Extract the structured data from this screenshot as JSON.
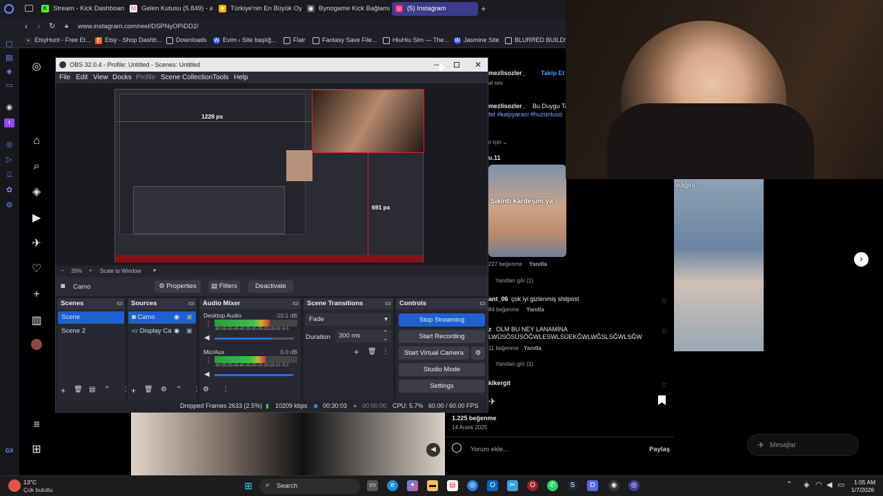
{
  "browser": {
    "tabs": [
      {
        "label": "Stream - Kick Dashboard",
        "icon": "kick-icon",
        "color": "#53fc18"
      },
      {
        "label": "Gelen Kutusu (5.849) - a...",
        "icon": "gmail-icon",
        "color": "#ea4335"
      },
      {
        "label": "Türkiye'nin En Büyük Oyu...",
        "icon": "site-icon",
        "color": "#f5b400"
      },
      {
        "label": "Bynogame Kick Bağlama",
        "icon": "globe-icon",
        "color": "#888888"
      },
      {
        "label": "(5) Instagram",
        "icon": "instagram-icon",
        "color": "#e1306c"
      }
    ],
    "url": "www.instagram.com/reel/DSPNyOPiDD2/",
    "bookmarks": [
      "EtsyHunt - Free Et...",
      "Etsy - Shop Dashb...",
      "Downloads",
      "Evim ‹ Site başlığ...",
      "Flair",
      "Fantasy Save File...",
      "HiuHiu Sim — The...",
      "Jasmine Site",
      "BLURRED BUILDS..."
    ]
  },
  "instagram": {
    "username": "mezlisozler_",
    "follow": "Takip Et",
    "audio": "al ses",
    "caption_user": "mezlisozler_",
    "caption": "Bu Duygu Tan",
    "hashtags": "fet #kalpyarası #huzunlusö",
    "translate": "n için ⌄",
    "comments": [
      {
        "user": "u.11",
        "likes": "227 beğenme",
        "reply": "Yanıtla",
        "view_replies": "Yanıtları gör (1)"
      },
      {
        "user": "ant_06",
        "text": "çok iyi gizlenmiş shitpost",
        "likes": "84 beğenme",
        "reply": "Yanıtla"
      },
      {
        "user": "z",
        "text": "OLM BU NEY LANAMİNA",
        "text2": "LWÜSÖSÜSÖĞWLESWLSÜEKĞWLWĞSLSĞWLSĞW",
        "likes": "11 beğenme",
        "reply": "Yanıtla",
        "view_replies": "Yanıtları gör (1)"
      },
      {
        "user": "klkergit"
      }
    ],
    "post_likes": "1.225 beğenme",
    "post_date": "14 Aralık 2025",
    "comment_placeholder": "Yorum ekle...",
    "share": "Paylaş",
    "video_text": "Sıkıntı kardeşim ya",
    "overlay_text": "vdiğini...",
    "messages": "Mesajlar",
    "next_icon": "chevron-right-icon"
  },
  "obs": {
    "title": "OBS 32.0.4 - Profile: Untitled - Scenes: Untitled",
    "menu": [
      "File",
      "Edit",
      "View",
      "Docks",
      "Profile",
      "Scene Collection",
      "Tools",
      "Help"
    ],
    "preview": {
      "label_w": "1229 px",
      "label_h": "691 px"
    },
    "zoom": "35%",
    "scale": "Scale to Window",
    "source_name": "Camo",
    "properties": "Properties",
    "filters": "Filters",
    "deactivate": "Deactivate",
    "scenes": {
      "title": "Scenes",
      "items": [
        "Scene",
        "Scene 2"
      ]
    },
    "sources": {
      "title": "Sources",
      "items": [
        "Camo",
        "Display Ca"
      ]
    },
    "mixer": {
      "title": "Audio Mixer",
      "channels": [
        {
          "name": "Desktop Audio",
          "db": "-10.1 dB",
          "level": 0.67,
          "fader": 0.72
        },
        {
          "name": "Mic/Aux",
          "db": "0.0 dB",
          "level": 0.62,
          "fader": 0.97
        }
      ],
      "scale": "-60-55-50-45-40-35-30-25-20-15-10 -5 0"
    },
    "transitions": {
      "title": "Scene Transitions",
      "type": "Fade",
      "duration_label": "Duration",
      "duration": "300 ms"
    },
    "controls": {
      "title": "Controls",
      "buttons": [
        "Stop Streaming",
        "Start Recording",
        "Start Virtual Camera",
        "Studio Mode",
        "Settings"
      ]
    },
    "status": {
      "dropped": "Dropped Frames 2633 (2.5%)",
      "bitrate": "10209 kbps",
      "stream_time": "00:30:03",
      "rec_time": "00:00:00",
      "cpu": "CPU: 5.7%",
      "fps": "60.00 / 60.00 FPS"
    }
  },
  "taskbar": {
    "weather_temp": "13°C",
    "weather_desc": "Çok bulutlu",
    "search": "Search",
    "time": "1:05 AM",
    "date": "1/7/2026"
  },
  "colors": {
    "accent": "#1f5fd1",
    "obs_bg": "#1e1f26",
    "ig_bg": "#000000",
    "tab_active": "#3b3b8f"
  }
}
